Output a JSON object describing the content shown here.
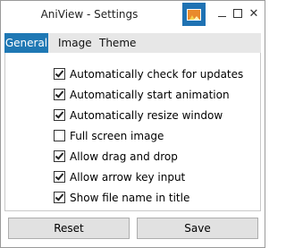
{
  "window": {
    "title": "AniView - Settings",
    "app_icon": "image-icon",
    "controls": [
      "minimize-icon",
      "maximize-icon",
      "close-icon"
    ]
  },
  "tabs": [
    {
      "label": "General",
      "active": true
    },
    {
      "label": "Image",
      "active": false
    },
    {
      "label": "Theme",
      "active": false
    }
  ],
  "general": {
    "options": [
      {
        "label": "Automatically check for updates",
        "checked": true
      },
      {
        "label": "Automatically start animation",
        "checked": true
      },
      {
        "label": "Automatically resize window",
        "checked": true
      },
      {
        "label": "Full screen image",
        "checked": false
      },
      {
        "label": "Allow drag and drop",
        "checked": true
      },
      {
        "label": "Allow arrow key input",
        "checked": true
      },
      {
        "label": "Show file name in title",
        "checked": true
      }
    ]
  },
  "buttons": {
    "reset_label": "Reset",
    "save_label": "Save"
  },
  "colors": {
    "accent": "#1f78b4",
    "tabbar_bg": "#e7e7e7",
    "button_bg": "#e1e1e1"
  }
}
